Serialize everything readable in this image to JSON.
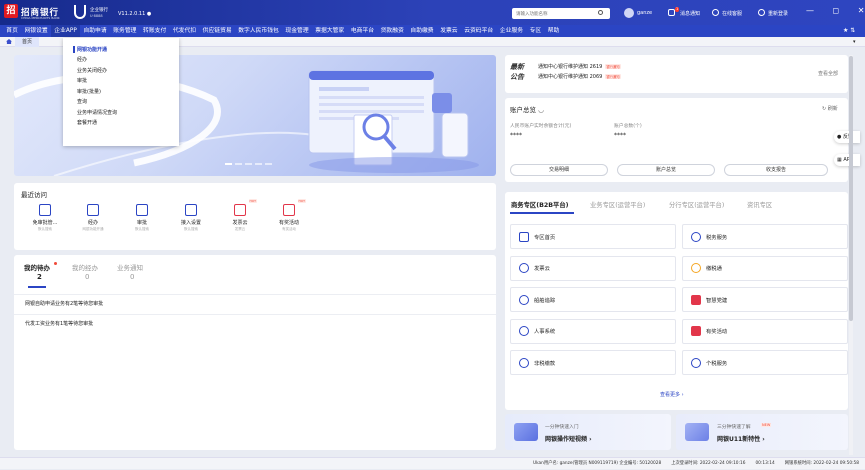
{
  "app": {
    "logo_glyph": "招",
    "bank_name": "招商银行",
    "bank_sub": "CHINA MERCHANTS BANK",
    "ebank_name": "企业银行",
    "ebank_sub": "U·8888",
    "version": "V11.2.0.11 ●"
  },
  "toolbar": {
    "search_placeholder": "请输入功能名称",
    "user": "ganze",
    "msg_label": "消息通知",
    "msg_badge": "1",
    "service_label": "在线客服",
    "logout_label": "重新登录",
    "window_controls": "— ◻ ✕"
  },
  "nav": {
    "items": [
      "首页",
      "网银设置",
      "企业APP",
      "自助申请",
      "账务管理",
      "转账支付",
      "代发代扣",
      "供应链贸易",
      "数字人民币钱包",
      "现金管理",
      "票据大管家",
      "电商平台",
      "贷款融资",
      "自助缴费",
      "发票云",
      "云资码平台",
      "企业服务",
      "专区",
      "帮助"
    ],
    "active_index": 2,
    "right": "★ ⇅"
  },
  "tabs": {
    "home": "首页",
    "arrow": "▾"
  },
  "dropdown": {
    "header": "网银功能开通",
    "items": [
      "经办",
      "业务关闭经办",
      "审批",
      "审批(批量)",
      "查询",
      "业务申请情况查询",
      "套餐开通"
    ]
  },
  "announcement": {
    "label_line1": "最新",
    "label_line2": "公告",
    "lines": [
      {
        "text": "通知中心银行维护通知 2619",
        "tag": "银行通知"
      },
      {
        "text": "通知中心银行维护通知 2069",
        "tag": "银行通知"
      }
    ],
    "more": "查看全部"
  },
  "account": {
    "title": "账户总览 ◡",
    "refresh": "↻ 刷新",
    "rmb_label": "人民币账户实时余额合计(元)",
    "rmb_value": "****",
    "count_label": "账户总数(个)",
    "count_value": "****",
    "buttons": [
      "交易明细",
      "账户总览",
      "收支报告"
    ]
  },
  "side": {
    "feedback": "● 反馈",
    "app": "▦ APP"
  },
  "recent": {
    "title": "最近访问",
    "items": [
      {
        "label": "免审批管...",
        "sub": "默认搜索"
      },
      {
        "label": "经办",
        "sub": "网银功能开通"
      },
      {
        "label": "审批",
        "sub": "默认搜索"
      },
      {
        "label": "接入设置",
        "sub": "默认搜索"
      },
      {
        "label": "发票云",
        "sub": "发票云",
        "hot": "HOT"
      },
      {
        "label": "有奖活动",
        "sub": "有奖活动",
        "hot": "HOT"
      }
    ]
  },
  "todo": {
    "tabs": [
      {
        "label": "我的待办",
        "count": "2"
      },
      {
        "label": "我的经办",
        "count": "0"
      },
      {
        "label": "业务通知",
        "count": "0"
      }
    ],
    "rows": [
      "网银自助申请业务有2笔等待您审批",
      "代发工资业务有1笔等待您审批"
    ]
  },
  "business": {
    "tabs": [
      "商务专区(B2B平台)",
      "业务专区(运营平台)",
      "分行专区(运营平台)",
      "资讯专区"
    ],
    "services": [
      "专区首页",
      "税务服务",
      "发票云",
      "缴税通",
      "船舶追踪",
      "智慧党建",
      "人事系统",
      "有奖活动",
      "非税缴款",
      "个税服务"
    ],
    "more": "查看更多 ›"
  },
  "promos": [
    {
      "top": "一分钟快速入门",
      "bold": "网银操作短视频 ›"
    },
    {
      "top": "三分钟快速了解",
      "bold": "网银U11新特性 ›",
      "new": "NEW"
    }
  ],
  "status": {
    "user": "Ukan用户名: ganze(管理员 N009119719) 企业编号: 50120028",
    "last_login": "上次登录时间: 2022-02-24 09:10:16",
    "online": "00:13:14",
    "sys_time": "网银系统时间: 2022-02-24 09:50:58"
  },
  "colors": {
    "brand_blue": "#2b45c4",
    "accent_red": "#e2364a"
  }
}
